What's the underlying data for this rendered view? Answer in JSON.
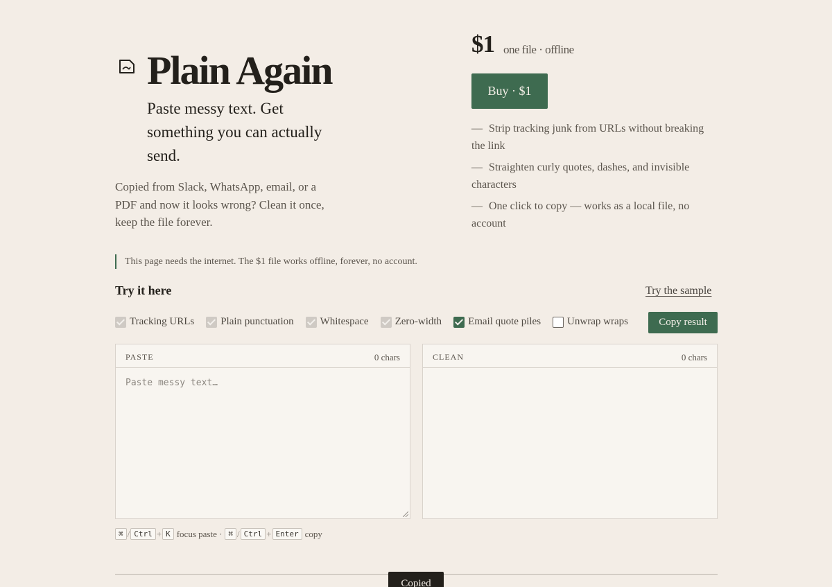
{
  "hero": {
    "logo_icon": "file-edit-icon",
    "title": "Plain Again",
    "tagline": "Paste messy text. Get something you can actually send.",
    "description": "Copied from Slack, WhatsApp, email, or a PDF and now it looks wrong? Clean it once, keep the file forever."
  },
  "pricing": {
    "price": "$1",
    "note": "one file · offline",
    "buy_label": "Buy · $1",
    "features": [
      "Strip tracking junk from URLs without breaking the link",
      "Straighten curly quotes, dashes, and invisible characters",
      "One click to copy — works as a local file, no account"
    ],
    "feature_marker": "—"
  },
  "notice": "This page needs the internet. The $1 file works offline, forever, no account.",
  "try": {
    "heading": "Try it here",
    "sample_link": "Try the sample",
    "copy_label": "Copy result",
    "options": [
      {
        "label": "Tracking URLs",
        "state": "checked-disabled"
      },
      {
        "label": "Plain punctuation",
        "state": "checked-disabled"
      },
      {
        "label": "Whitespace",
        "state": "checked-disabled"
      },
      {
        "label": "Zero-width",
        "state": "checked-disabled"
      },
      {
        "label": "Email quote piles",
        "state": "checked"
      },
      {
        "label": "Unwrap wraps",
        "state": "unchecked"
      }
    ]
  },
  "paste_panel": {
    "label": "PASTE",
    "count": "0 chars",
    "placeholder": "Paste messy text…",
    "value": ""
  },
  "clean_panel": {
    "label": "CLEAN",
    "count": "0 chars",
    "value": ""
  },
  "shortcuts": {
    "mod_mac": "⌘",
    "mod_pc": "Ctrl",
    "slash": "/",
    "plus": "+",
    "focus_key": "K",
    "focus_text": "focus paste ·",
    "copy_key": "Enter",
    "copy_text": "copy"
  },
  "bottom_tab": "Copied",
  "colors": {
    "accent": "#3e6b50",
    "background": "#f3ede6",
    "text": "#23201b"
  }
}
